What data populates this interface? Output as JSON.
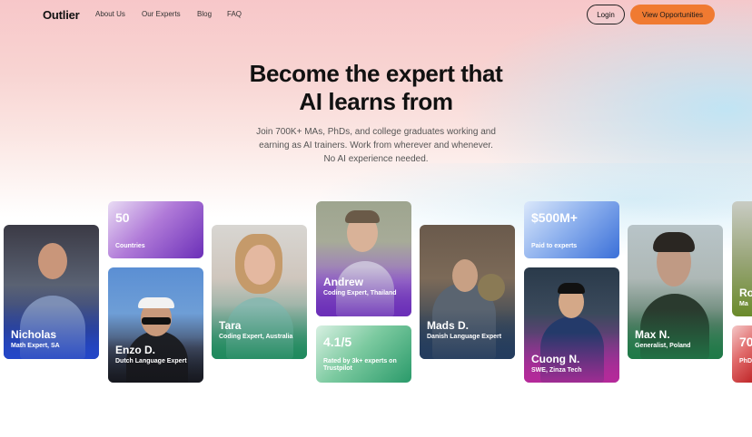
{
  "nav": {
    "logo": "Outlier",
    "links": [
      "About Us",
      "Our Experts",
      "Blog",
      "FAQ"
    ],
    "login": "Login",
    "cta": "View Opportunities"
  },
  "hero": {
    "title_line1": "Become the expert that",
    "title_line2": "AI learns from",
    "sub_line1": "Join 700K+ MAs, PhDs, and college graduates working and",
    "sub_line2": "earning as AI trainers. Work from wherever and whenever.",
    "sub_line3": "No AI experience needed."
  },
  "experts": [
    {
      "name": "Nicholas",
      "role": "Math Expert, SA"
    },
    {
      "name": "Enzo D.",
      "role": "Dutch Language Expert"
    },
    {
      "name": "Tara",
      "role": "Coding Expert, Australia"
    },
    {
      "name": "Andrew",
      "role": "Coding Expert, Thailand"
    },
    {
      "name": "Mads D.",
      "role": "Danish Language Expert"
    },
    {
      "name": "Cuong N.",
      "role": "SWE, Zinza Tech"
    },
    {
      "name": "Max N.",
      "role": "Generalist, Poland"
    },
    {
      "name": "Ro",
      "role": "Ma"
    }
  ],
  "stats": [
    {
      "value": "50",
      "caption": "Countries"
    },
    {
      "value": "4.1/5",
      "caption": "Rated by 3k+ experts on Trustpilot"
    },
    {
      "value": "$500M+",
      "caption": "Paid to experts"
    },
    {
      "value": "70",
      "caption": "PhD onb"
    }
  ],
  "colors": {
    "accent": "#f07a31",
    "purple": "#6b2fb8",
    "green": "#2a9a6a",
    "blue": "#3a6fd8",
    "magenta": "#b52a9a"
  }
}
